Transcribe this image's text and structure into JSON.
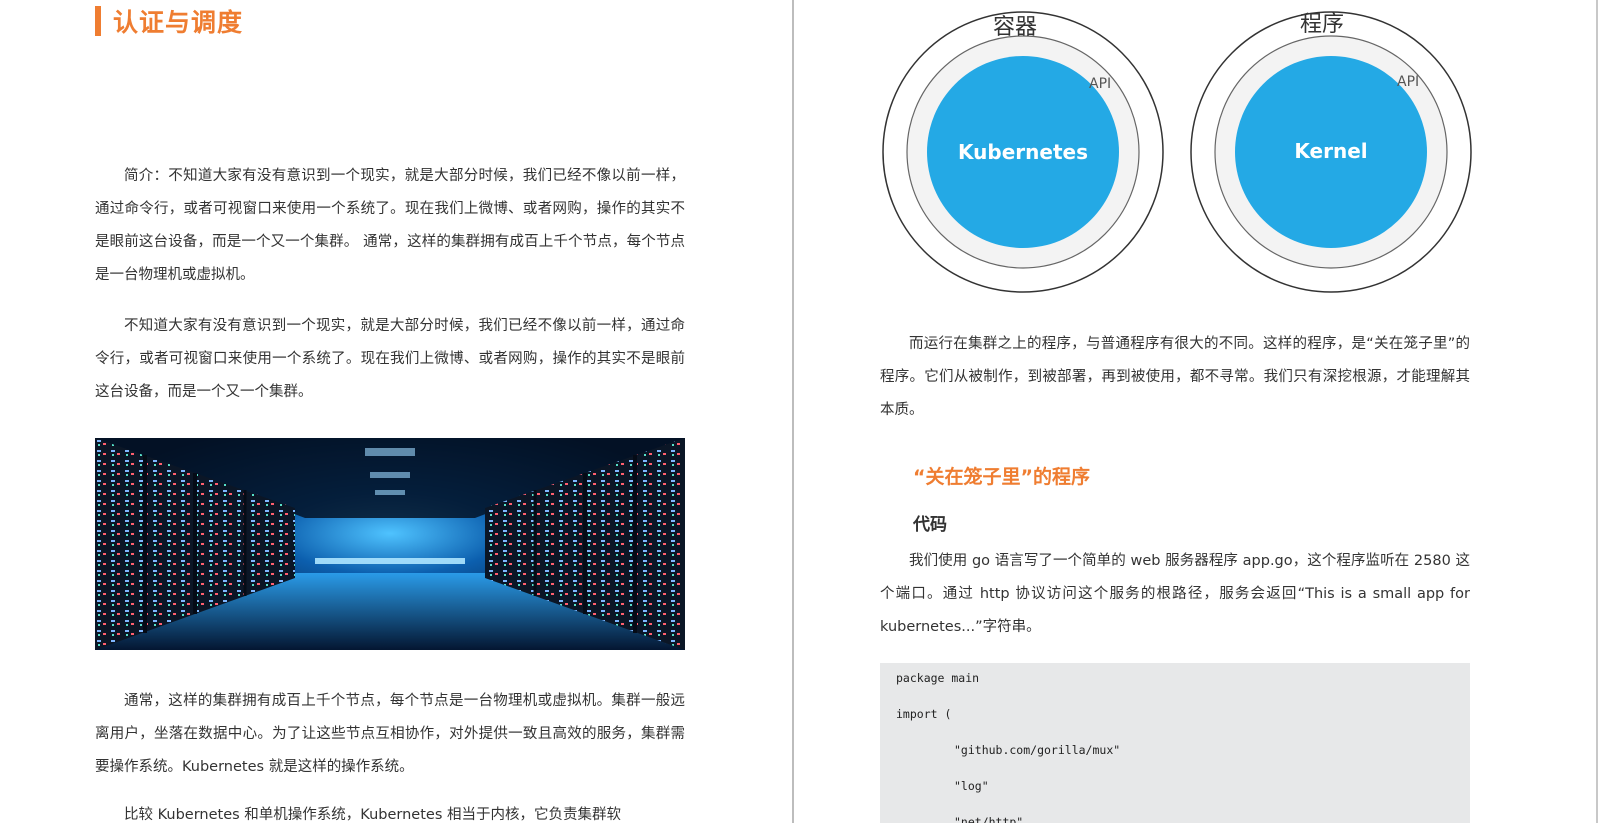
{
  "left_page": {
    "chapter_title": "认证与调度",
    "paragraphs": [
      "简介：不知道大家有没有意识到一个现实，就是大部分时候，我们已经不像以前一样，通过命令行，或者可视窗口来使用一个系统了。现在我们上微博、或者网购，操作的其实不是眼前这台设备，而是一个又一个集群。 通常，这样的集群拥有成百上千个节点，每个节点是一台物理机或虚拟机。",
      "不知道大家有没有意识到一个现实，就是大部分时候，我们已经不像以前一样，通过命令行，或者可视窗口来使用一个系统了。现在我们上微博、或者网购，操作的其实不是眼前这台设备，而是一个又一个集群。",
      "通常，这样的集群拥有成百上千个节点，每个节点是一台物理机或虚拟机。集群一般远离用户，坐落在数据中心。为了让这些节点互相协作，对外提供一致且高效的服务，集群需要操作系统。Kubernetes 就是这样的操作系统。",
      "比较 Kubernetes 和单机操作系统，Kubernetes 相当于内核，它负责集群软"
    ]
  },
  "diagram": {
    "left": {
      "label": "容器",
      "api": "API",
      "core": "Kubernetes"
    },
    "right": {
      "label": "程序",
      "api": "API",
      "core": "Kernel"
    },
    "core_color": "#24a9e5"
  },
  "right_page": {
    "paragraph1": "而运行在集群之上的程序，与普通程序有很大的不同。这样的程序，是“关在笼子里”的程序。它们从被制作，到被部署，再到被使用，都不寻常。我们只有深挖根源，才能理解其本质。",
    "section_title": "“关在笼子里”的程序",
    "sub_title": "代码",
    "paragraph2": "我们使用 go 语言写了一个简单的 web 服务器程序 app.go，这个程序监听在 2580 这个端口。通过 http 协议访问这个服务的根路径，服务会返回“This is a small app for kubernetes...”字符串。",
    "code_lines": [
      "package main",
      "import (",
      "\"github.com/gorilla/mux\"",
      "\"log\"",
      "\"net/http\""
    ]
  },
  "colors": {
    "accent": "#ef7d31",
    "code_bg": "#e7e8e9"
  }
}
